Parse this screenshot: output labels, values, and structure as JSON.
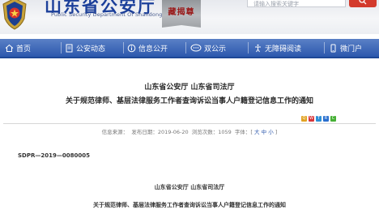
{
  "header": {
    "site_title": "山东省公安厅",
    "site_subtitle": "Public Security Department Of Shandong Province",
    "motto": "藏揭尊",
    "search": {
      "placeholder": "请输入搜索关键字"
    },
    "colors": {
      "title": "#1b3f9a",
      "search_button": "#d33a2c",
      "motto_text": "#9a1b1b"
    }
  },
  "nav": {
    "colors": {
      "bar": "#2c58ad",
      "text": "#ffffff"
    },
    "items": [
      {
        "label": "首页",
        "icon": "home-icon"
      },
      {
        "label": "公安动态",
        "icon": "document-icon"
      },
      {
        "label": "信息公开",
        "icon": "info-icon"
      },
      {
        "label": "双公示",
        "icon": "chat-icon"
      },
      {
        "label": "无障碍阅读",
        "icon": "accessibility-icon"
      },
      {
        "label": "微门户",
        "icon": "phone-icon"
      }
    ]
  },
  "article": {
    "issuers": "山东省公安厅 山东省司法厅",
    "title": "关于规范律师、基层法律服务工作者查询诉讼当事人户籍登记信息工作的通知",
    "share_icons": [
      "qzone-share-icon",
      "weibo-share-icon",
      "tencent-share-icon",
      "renren-share-icon",
      "wechat-share-icon"
    ],
    "meta": {
      "source_label": "信息来源：",
      "date_label": "发布日期：2019-06-20",
      "views_label": "浏览次数：1059",
      "font_label": "字体：[",
      "font_large": "大",
      "font_medium": "中",
      "font_small": "小",
      "font_end": "]"
    },
    "doc_number": "SDPR—2019—0080005",
    "body_issuers": "山东省公安厅 山东省司法厅",
    "body_title": "关于规范律师、基层法律服务工作者查询诉讼当事人户籍登记信息工作的通知"
  }
}
